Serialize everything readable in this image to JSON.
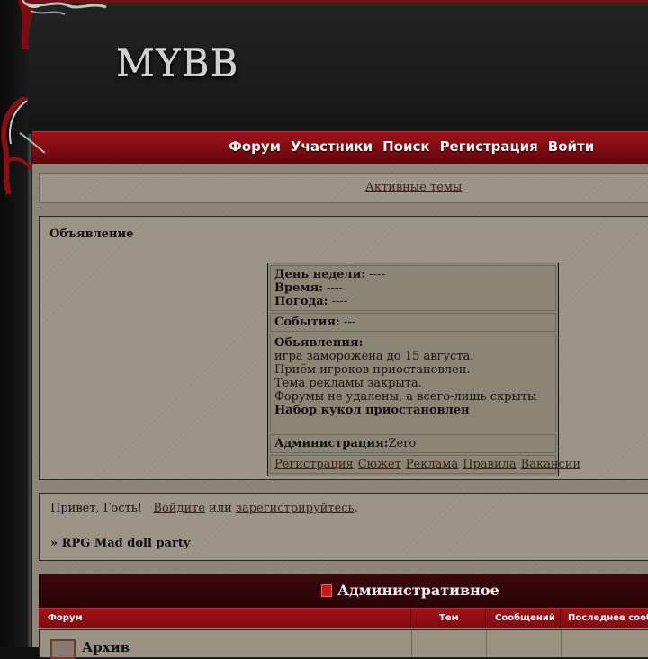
{
  "site": {
    "logo": "MYBB"
  },
  "nav": [
    {
      "label": "Форум"
    },
    {
      "label": "Участники"
    },
    {
      "label": "Поиск"
    },
    {
      "label": "Регистрация"
    },
    {
      "label": "Войти"
    }
  ],
  "active_topics": {
    "label": "Активные темы"
  },
  "announcement": {
    "title": "Объявление",
    "day_label": "День недели:",
    "day_value": " ----",
    "time_label": "Время:",
    "time_value": " ----",
    "weather_label": "Погода:",
    "weather_value": " ----",
    "events_label": "События:",
    "events_value": " ---",
    "ads_label": "Обьявления:",
    "ads_lines": [
      "игра заморожена до 15 августа.",
      "Приём игроков приостановлен.",
      "Тема рекламы закрыта.",
      "Форумы не удалены, а всего-лишь скрыты"
    ],
    "ads_bold": "Набор кукол приостановлен",
    "admin_label": "Администрация:",
    "admin_value": "Zero",
    "links": [
      "Регистрация",
      "Сюжет",
      "Реклама",
      "Правила",
      "Вакансии"
    ]
  },
  "greeting": {
    "hello": "Привет, Гость!",
    "login_link": "Войдите",
    "or": " или ",
    "register_link": "зарегистрируйтесь",
    "period": ".",
    "board_title": "» RPG Mad doll party"
  },
  "category": {
    "title": "Административное",
    "columns": [
      "Форум",
      "Тем",
      "Сообщений",
      "Последнее сообщ"
    ],
    "rows": [
      {
        "name": "Архив"
      }
    ]
  },
  "colors": {
    "accent": "#7b0b11",
    "panel": "#9a9384",
    "link": "#3b2118"
  }
}
